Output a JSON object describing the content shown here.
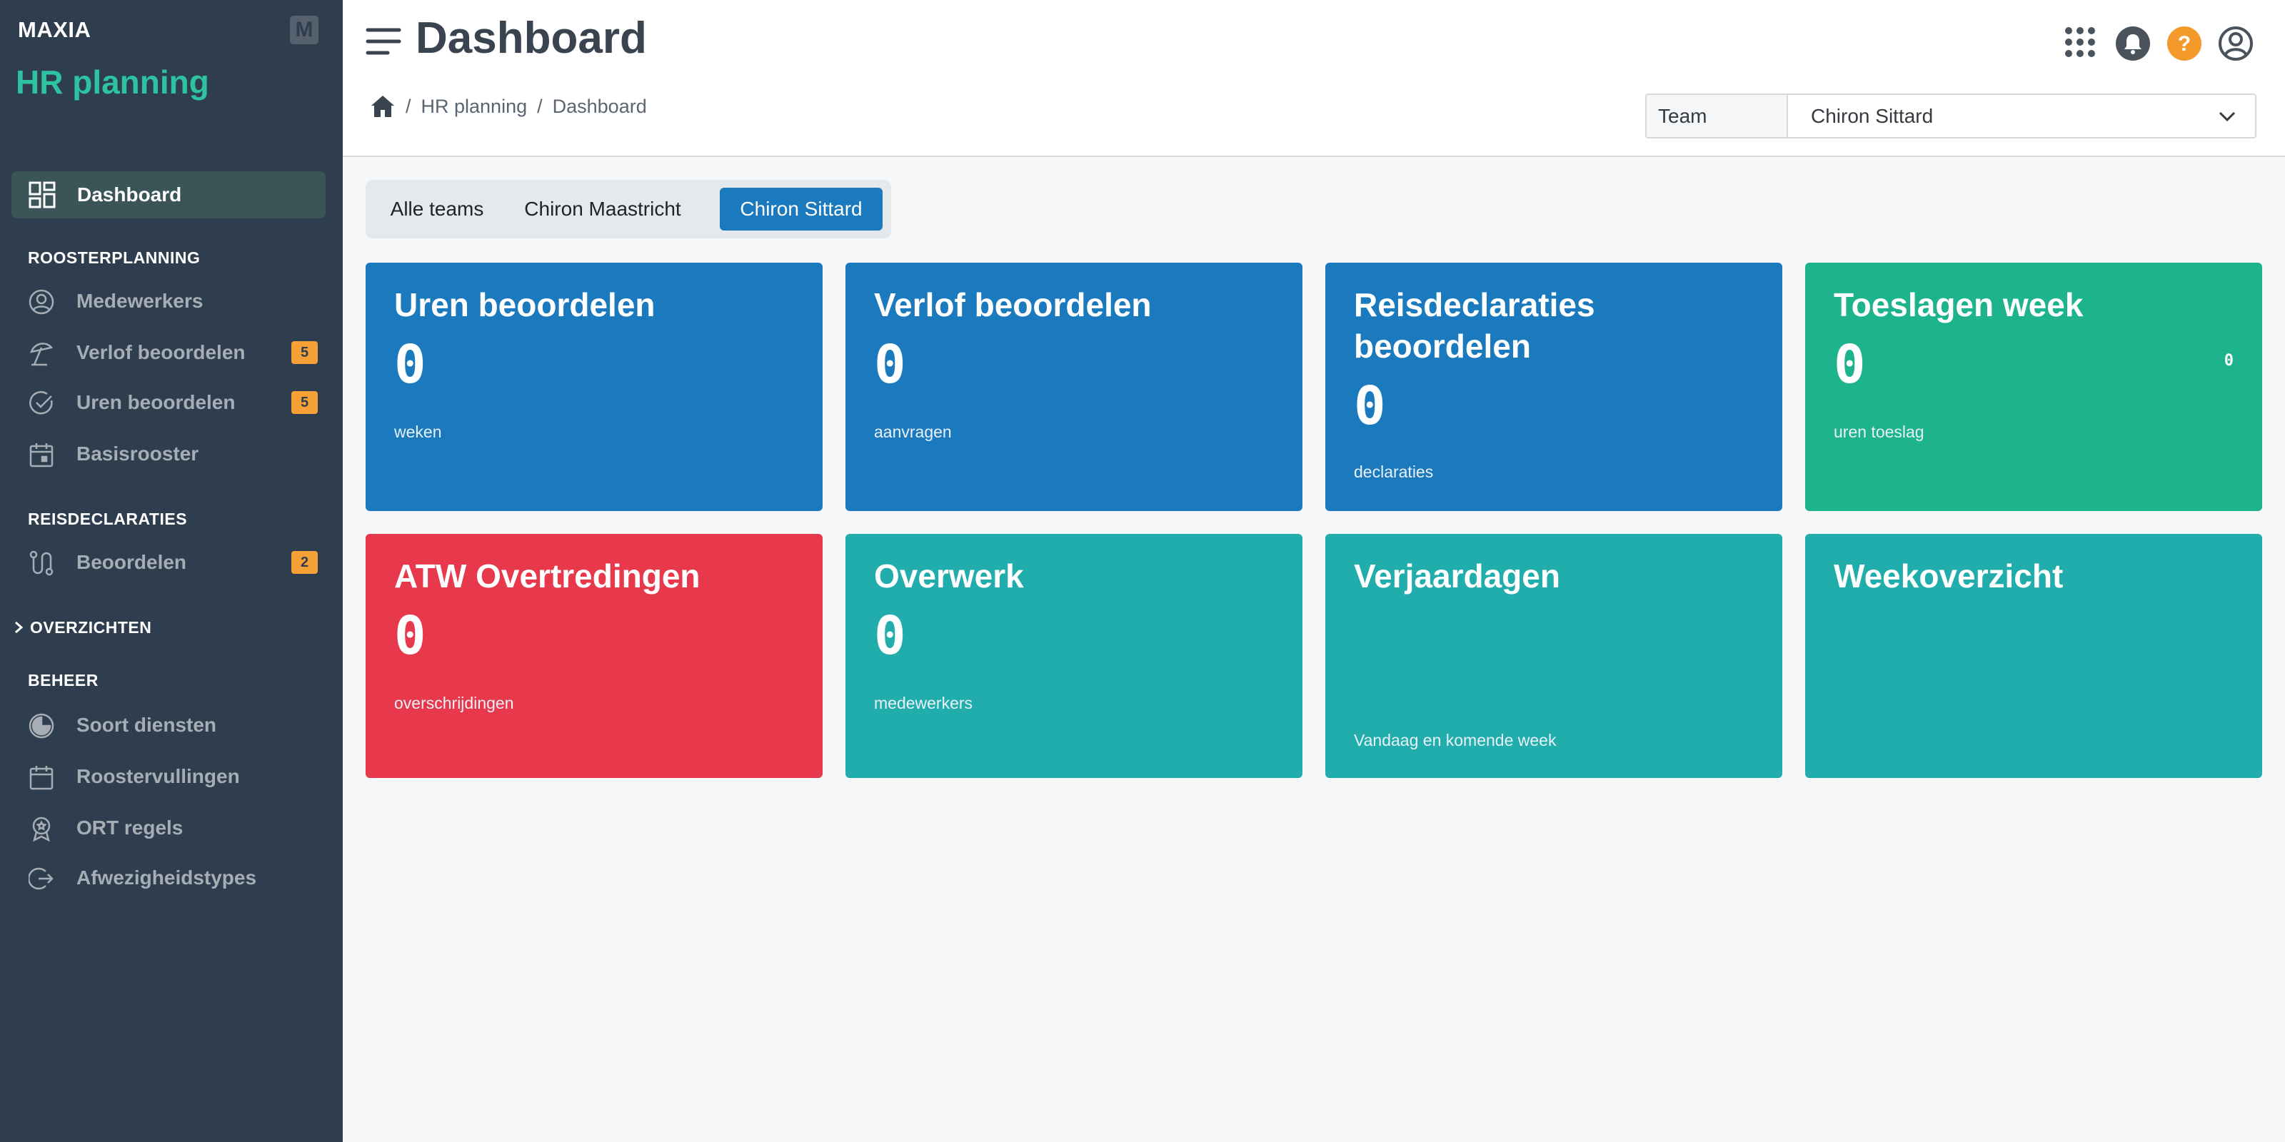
{
  "app": {
    "brand": "MAXIA",
    "brand_mark": "M",
    "module": "HR planning"
  },
  "sidebar": {
    "dashboard": "Dashboard",
    "sections": {
      "roosterplanning": "ROOSTERPLANNING",
      "reisdeclaraties": "REISDECLARATIES",
      "overzichten": "OVERZICHTEN",
      "beheer": "BEHEER"
    },
    "items": {
      "medewerkers": "Medewerkers",
      "verlof": {
        "label": "Verlof beoordelen",
        "badge": "5"
      },
      "uren": {
        "label": "Uren beoordelen",
        "badge": "5"
      },
      "basisrooster": "Basisrooster",
      "beoordelen": {
        "label": "Beoordelen",
        "badge": "2"
      },
      "soort_diensten": "Soort diensten",
      "roostervullingen": "Roostervullingen",
      "ort_regels": "ORT regels",
      "afwezigheidstypes": "Afwezigheidstypes"
    }
  },
  "header": {
    "title": "Dashboard",
    "breadcrumb": [
      "HR planning",
      "Dashboard"
    ],
    "team_label": "Team",
    "team_value": "Chiron Sittard"
  },
  "tabs": [
    "Alle teams",
    "Chiron Maastricht",
    "Chiron Sittard"
  ],
  "active_tab": "Chiron Sittard",
  "cards": {
    "uren": {
      "title": "Uren beoordelen",
      "value": "0",
      "unit": "weken",
      "color": "#1b79be"
    },
    "verlof": {
      "title": "Verlof beoordelen",
      "value": "0",
      "unit": "aanvragen",
      "color": "#1b79be"
    },
    "reis": {
      "title": "Reisdeclaraties beoordelen",
      "value": "0",
      "unit": "declaraties",
      "color": "#1b79be"
    },
    "toeslagen": {
      "title": "Toeslagen week",
      "value": "0",
      "corner": "0",
      "unit": "uren toeslag",
      "color": "#1cb38d"
    },
    "atw": {
      "title": "ATW Overtredingen",
      "value": "0",
      "unit": "overschrijdingen",
      "color": "#e8384c"
    },
    "overwerk": {
      "title": "Overwerk",
      "value": "0",
      "unit": "medewerkers",
      "color": "#20adac"
    },
    "verjaardagen": {
      "title": "Verjaardagen",
      "unit": "Vandaag en komende week",
      "color": "#20adac"
    },
    "weekoverzicht": {
      "title": "Weekoverzicht",
      "color": "#20adac"
    }
  },
  "colors": {
    "sidebar": "#2f3e4e",
    "accent": "#2dc2a0",
    "badge": "#f7a035",
    "help": "#f39a2b"
  }
}
